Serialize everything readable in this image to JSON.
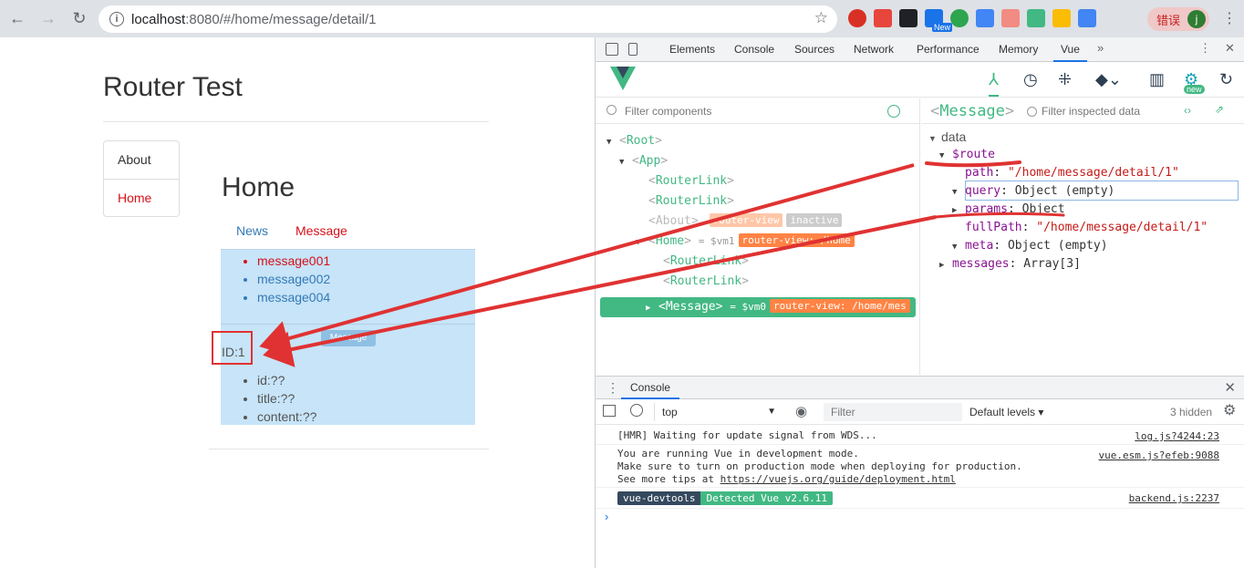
{
  "browser": {
    "url_host": "localhost",
    "url_path": ":8080/#/home/message/detail/1",
    "error_label": "错误",
    "avatar_letter": "j",
    "ext_new_badge": "New"
  },
  "page": {
    "title": "Router Test",
    "sidenav": [
      {
        "label": "About"
      },
      {
        "label": "Home"
      }
    ],
    "home_title": "Home",
    "tabs": {
      "news": "News",
      "message": "Message"
    },
    "messages": [
      "message001",
      "message002",
      "message004"
    ],
    "chip": "Message",
    "id_label": "ID:1",
    "detail": [
      "id:??",
      "title:??",
      "content:??"
    ]
  },
  "devtools": {
    "tabs": [
      "Elements",
      "Console",
      "Sources",
      "Network",
      "Performance",
      "Memory",
      "Vue"
    ],
    "selected_tab": "Vue",
    "more": "»",
    "vue_new_badge": "new",
    "filter_components": "Filter components",
    "tree": {
      "root": "Root",
      "app": "App",
      "routerlink": "RouterLink",
      "about": "About",
      "router_view": "router-view",
      "inactive": "inactive",
      "home": "Home",
      "vm1": "= $vm1",
      "router_view_home": "router-view: /home",
      "message": "Message",
      "vm0": "= $vm0",
      "router_view_mes": "router-view: /home/mes"
    },
    "inspected": {
      "component": "Message",
      "filter_placeholder": "Filter inspected data",
      "section_data": "data",
      "route": "$route",
      "path_key": "path",
      "path_val": "\"/home/message/detail/1\"",
      "query_key": "query",
      "query_val": "Object (empty)",
      "params_key": "params",
      "params_val": "Object",
      "fullpath_key": "fullPath",
      "fullpath_val": "\"/home/message/detail/1\"",
      "meta_key": "meta",
      "meta_val": "Object (empty)",
      "messages_key": "messages",
      "messages_val": "Array[3]"
    },
    "console": {
      "tab": "Console",
      "context": "top",
      "filter_placeholder": "Filter",
      "levels": "Default levels",
      "hidden": "3 hidden",
      "messages": [
        {
          "text": "[HMR] Waiting for update signal from WDS...",
          "source": "log.js?4244:23"
        },
        {
          "lines": [
            "You are running Vue in development mode.",
            "Make sure to turn on production mode when deploying for production.",
            "See more tips at "
          ],
          "link": "https://vuejs.org/guide/deployment.html",
          "source": "vue.esm.js?efeb:9088"
        },
        {
          "badge1": "vue-devtools",
          "badge2": "Detected Vue v2.6.11",
          "source": "backend.js:2237"
        }
      ]
    }
  },
  "colors": {
    "vue_green": "#42b883",
    "annotation_red": "#e03232",
    "active_red": "#d6101a",
    "link_blue": "#337ab7",
    "msg_bg": "#c7e4f8"
  }
}
